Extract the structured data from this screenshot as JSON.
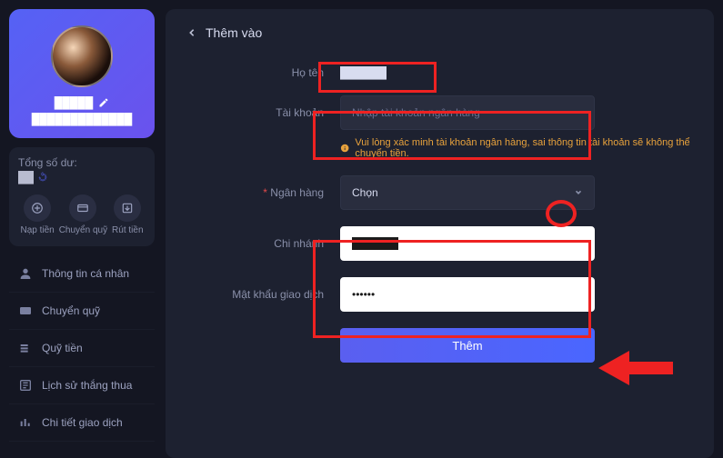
{
  "profile": {
    "name": "█████",
    "line2": "█████████████",
    "edit_icon": "pencil-icon"
  },
  "balance": {
    "label": "Tổng số dư:",
    "value": "██"
  },
  "quick_actions": {
    "deposit": "Nạp tiền",
    "transfer": "Chuyển quỹ",
    "withdraw": "Rút tiền"
  },
  "nav": {
    "items": [
      {
        "label": "Thông tin cá nhân",
        "icon": "user"
      },
      {
        "label": "Chuyển quỹ",
        "icon": "wallet"
      },
      {
        "label": "Quỹ tiền",
        "icon": "coins"
      },
      {
        "label": "Lịch sử thắng thua",
        "icon": "history"
      },
      {
        "label": "Chi tiết giao dịch",
        "icon": "bars"
      }
    ]
  },
  "panel": {
    "title": "Thêm vào"
  },
  "form": {
    "name_label": "Họ tên",
    "name_value": "██████",
    "account_label": "Tài khoản",
    "account_placeholder": "Nhập tài khoản ngân hàng",
    "hint": "Vui lòng xác minh tài khoản ngân hàng, sai thông tin tài khoản sẽ không thể chuyển tiền.",
    "bank_label": "Ngân hàng",
    "bank_selected": "Chọn",
    "branch_label": "Chi nhánh",
    "branch_value": "██████",
    "password_label": "Mật khẩu giao dịch",
    "password_value": "••••••",
    "submit": "Thêm"
  }
}
